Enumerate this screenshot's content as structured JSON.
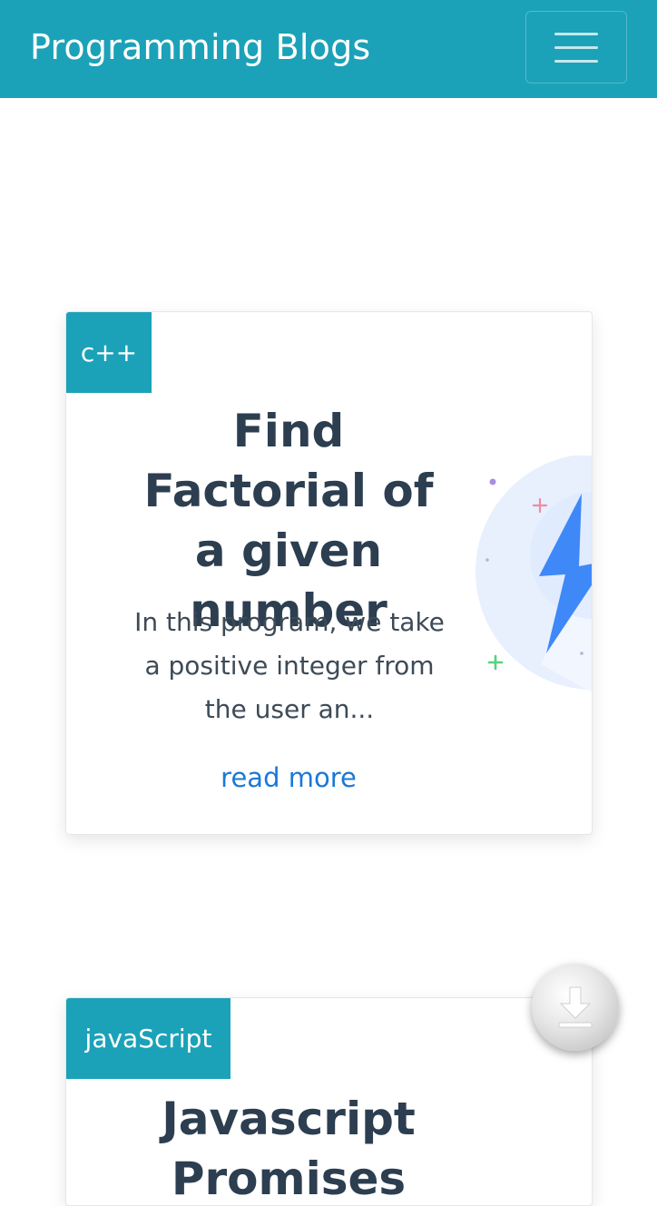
{
  "navbar": {
    "brand": "Programming Blogs",
    "toggle_icon": "hamburger-menu-icon",
    "background": "#1ba2b8"
  },
  "posts": [
    {
      "category": "c++",
      "title": "Find Factorial of a given number",
      "excerpt": "In this program, we take a positive integer from the user an...",
      "read_more": "read more",
      "image_icon": "lightning-bolt-icon"
    },
    {
      "category": "javaScript",
      "title": "Javascript Promises"
    }
  ],
  "fab": {
    "icon": "download-icon"
  },
  "colors": {
    "accent": "#1ba2b8",
    "title": "#2c3e50",
    "link": "#1b78d6"
  }
}
